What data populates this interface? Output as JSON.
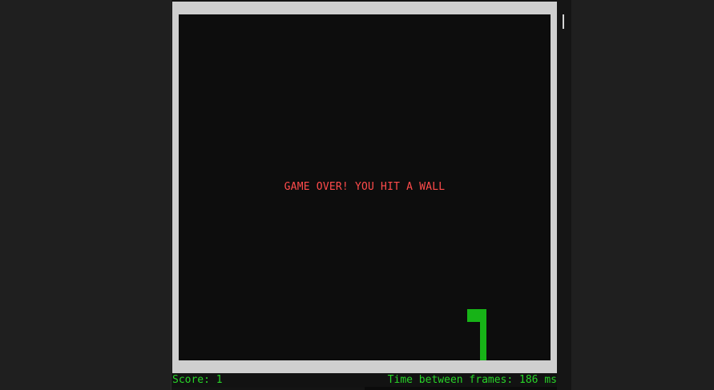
{
  "game": {
    "message": "GAME OVER! YOU HIT A WALL",
    "score_text": "Score: 1",
    "frame_time_text": "Time between frames: 186 ms"
  },
  "colors": {
    "snake": "#17b317",
    "message": "#ff4b4b",
    "status": "#28d428",
    "playfield": "#0d0d0d",
    "border": "#cfcfcf"
  }
}
